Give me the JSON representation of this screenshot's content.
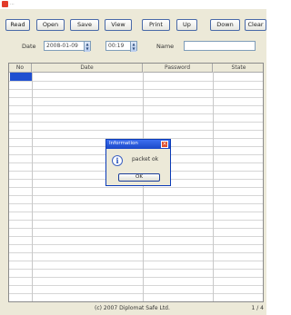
{
  "window": {
    "title": "..."
  },
  "toolbar": {
    "read": "Read",
    "open": "Open",
    "save": "Save",
    "view": "View",
    "print": "Print",
    "up": "Up",
    "down": "Down",
    "clear": "Clear"
  },
  "filter": {
    "date_label": "Date",
    "date_value": "2008-01-09",
    "time_value": "00:19",
    "name_label": "Name",
    "name_value": ""
  },
  "table": {
    "columns": [
      "No",
      "Date",
      "Password",
      "State"
    ]
  },
  "dialog": {
    "title": "Information",
    "message": "packet ok",
    "ok_label": "OK"
  },
  "status": {
    "text": "(c) 2007 Diplomat Safe Ltd.",
    "page": "1 / 4"
  },
  "icons": [
    "app-icon",
    "spin-up-icon",
    "spin-down-icon",
    "info-icon",
    "close-icon"
  ]
}
